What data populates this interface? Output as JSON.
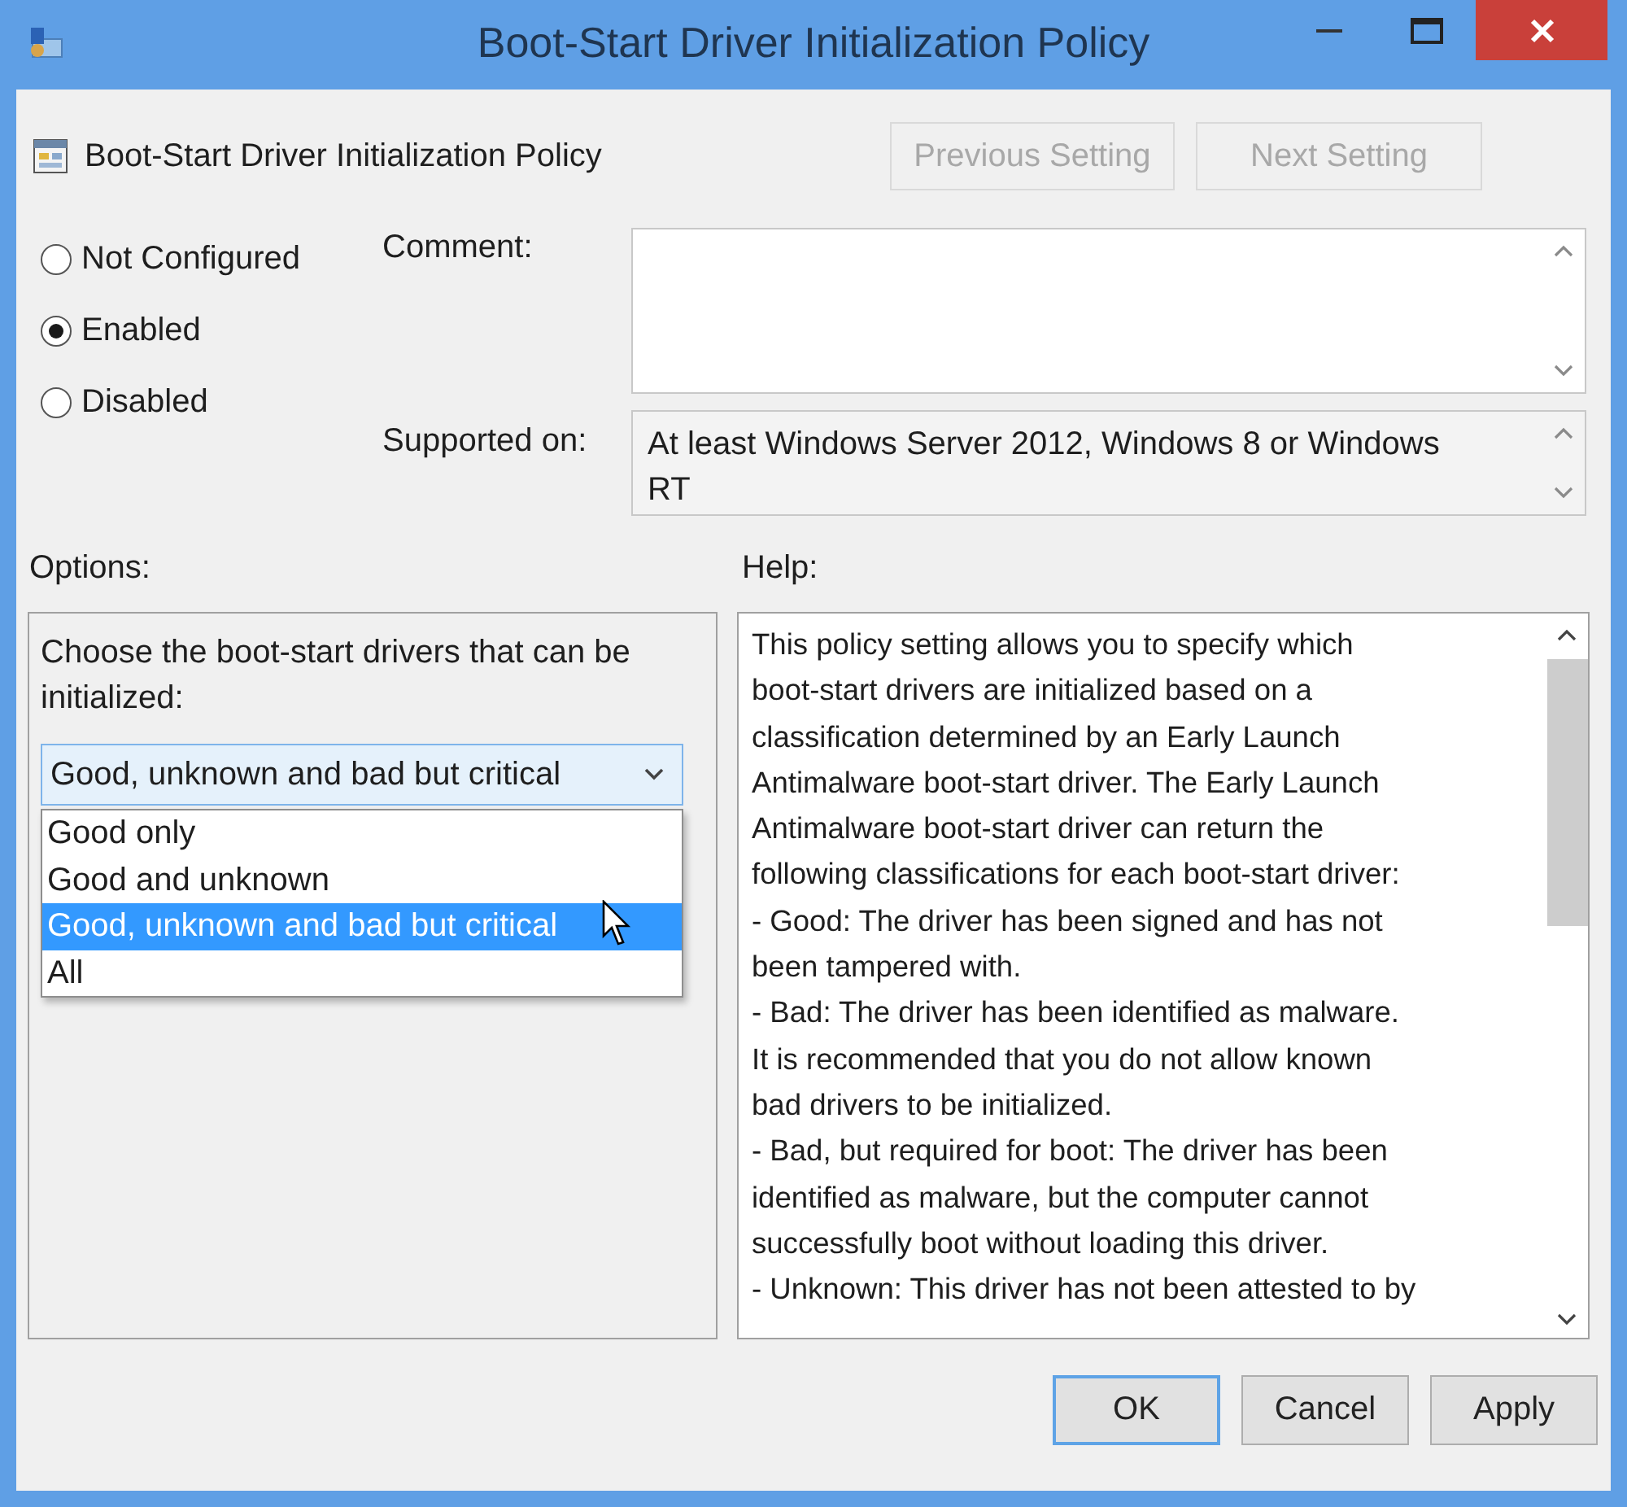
{
  "window": {
    "title": "Boot-Start Driver Initialization Policy"
  },
  "header": {
    "title": "Boot-Start Driver Initialization Policy",
    "buttons": [
      {
        "label": "Previous Setting",
        "disabled": true
      },
      {
        "label": "Next Setting",
        "disabled": true
      }
    ]
  },
  "state_options": [
    {
      "label": "Not Configured",
      "selected": false
    },
    {
      "label": "Enabled",
      "selected": true
    },
    {
      "label": "Disabled",
      "selected": false
    }
  ],
  "comment": {
    "label": "Comment:"
  },
  "supported_on": {
    "label": "Supported on:",
    "value": "At least Windows Server 2012, Windows 8 or Windows RT"
  },
  "options": {
    "label": "Options:",
    "prompt": "Choose the boot-start drivers that can be initialized:",
    "dropdown": {
      "value": "Good, unknown and bad but critical",
      "expanded": true,
      "items": [
        {
          "label": "Good only",
          "selected": false
        },
        {
          "label": "Good and unknown",
          "selected": false
        },
        {
          "label": "Good, unknown and bad but critical",
          "selected": true
        },
        {
          "label": "All",
          "selected": false
        }
      ]
    }
  },
  "help": {
    "label": "Help:",
    "lines": [
      "This policy setting allows you to specify which",
      "boot-start drivers are initialized based on a",
      "classification determined by an Early Launch",
      "Antimalware boot-start driver. The Early Launch",
      "Antimalware boot-start driver can return the",
      "following classifications for each boot-start driver:",
      "-  Good: The driver has been signed and has not",
      "been tampered with.",
      "-  Bad: The driver has been identified as malware.",
      "It is recommended that you do not allow known",
      "bad drivers to be initialized.",
      "-  Bad, but required for boot: The driver has been",
      "identified as malware, but the computer cannot",
      "successfully boot without loading this driver.",
      "-  Unknown: This driver has not been attested to by"
    ]
  },
  "buttons": [
    {
      "label": "OK",
      "default": true
    },
    {
      "label": "Cancel",
      "default": false
    },
    {
      "label": "Apply",
      "default": false
    }
  ]
}
